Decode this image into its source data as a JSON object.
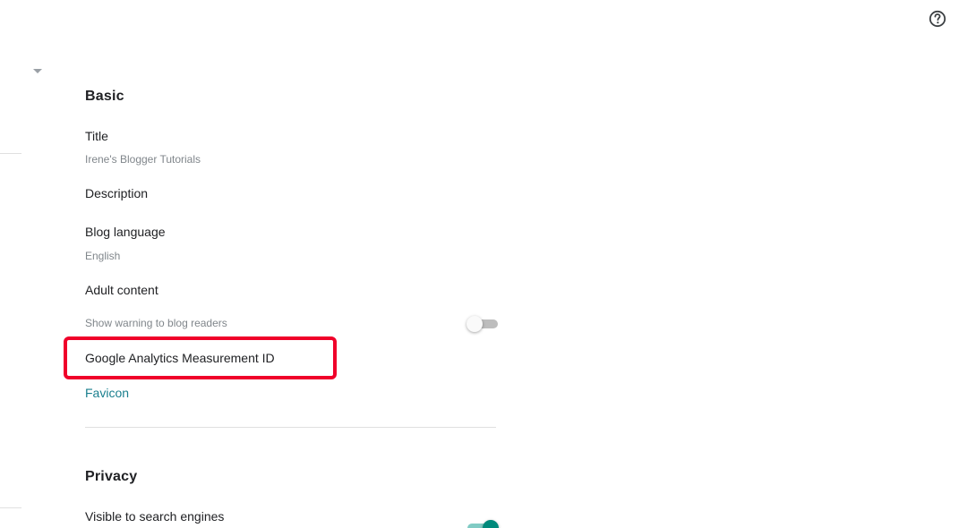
{
  "header": {
    "help_icon": "help-circle-icon",
    "dropdown_icon": "caret-down-icon"
  },
  "basic": {
    "title": "Basic",
    "items": [
      {
        "label": "Title",
        "value": "Irene's Blogger Tutorials"
      },
      {
        "label": "Description"
      },
      {
        "label": "Blog language",
        "value": "English"
      },
      {
        "label": "Adult content",
        "value": "Show warning to blog readers",
        "toggle": "off"
      },
      {
        "label": "Google Analytics Measurement ID"
      },
      {
        "label": "Favicon"
      }
    ]
  },
  "privacy": {
    "title": "Privacy",
    "items": [
      {
        "label": "Visible to search engines",
        "toggle": "on"
      }
    ]
  },
  "colors": {
    "highlight": "#f0002a",
    "link": "#1a7f8e",
    "toggle_on": "#00897b"
  }
}
